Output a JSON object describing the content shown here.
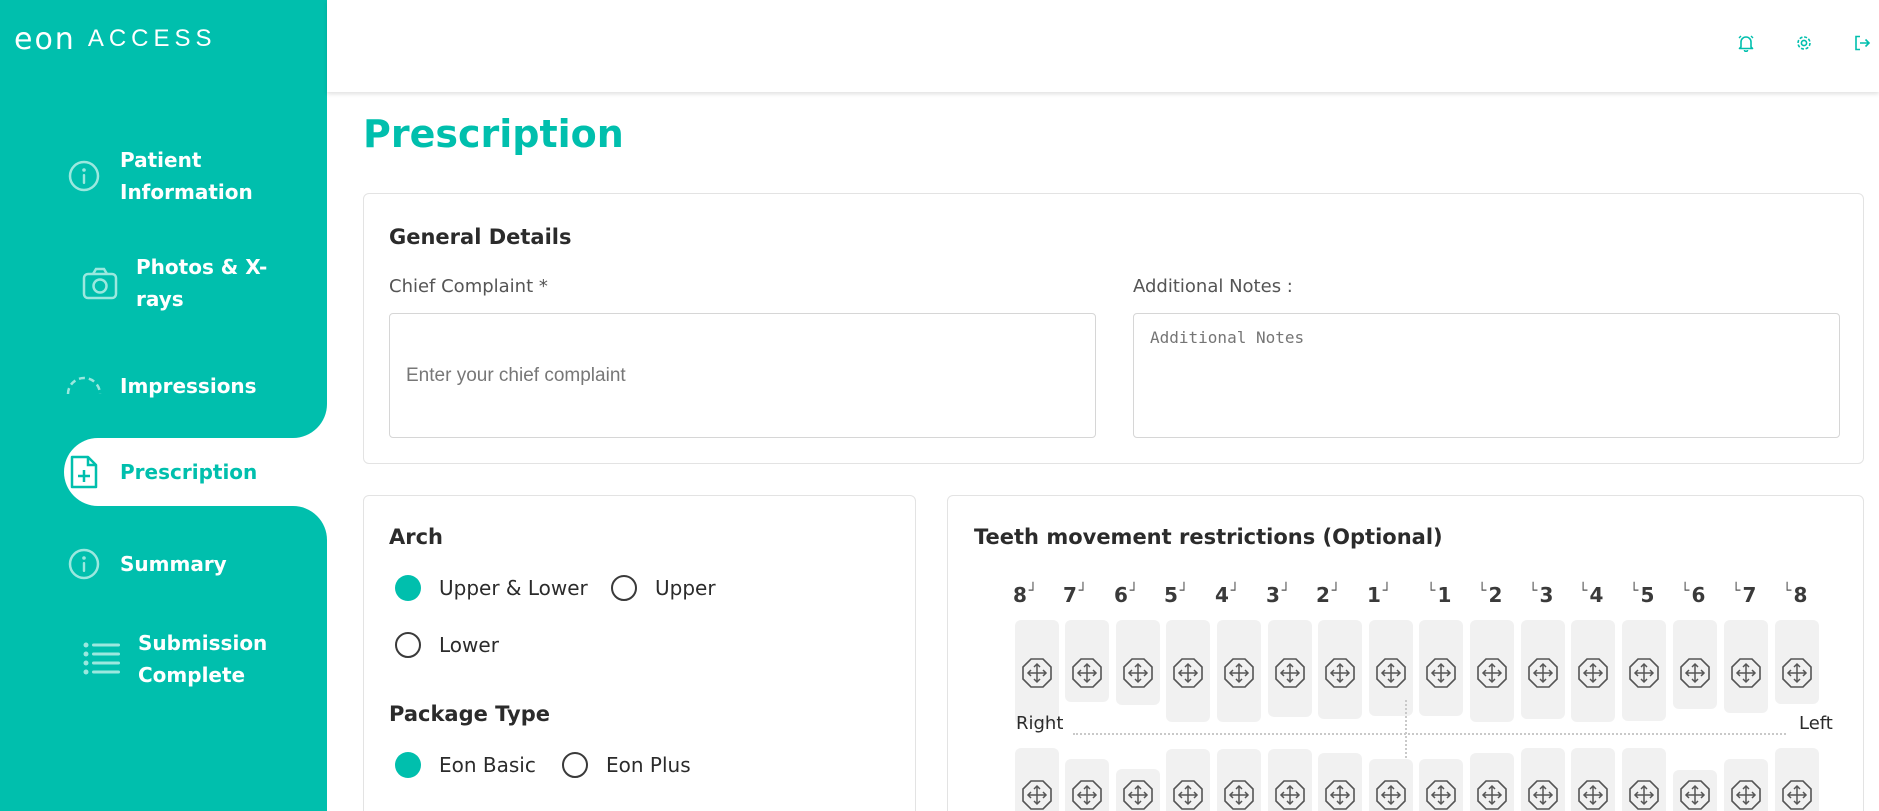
{
  "app": {
    "logo_main": "eon",
    "logo_sub": "ACCESS"
  },
  "colors": {
    "brand": "#00bfad",
    "text": "#2b2b2b",
    "muted": "#555555",
    "border": "#e3e3e3"
  },
  "sidebar": {
    "items": [
      {
        "label": "Patient Information",
        "icon": "info-icon",
        "active": false
      },
      {
        "label": "Photos & X-rays",
        "icon": "camera-icon",
        "active": false
      },
      {
        "label": "Impressions",
        "icon": "arc-icon",
        "active": false
      },
      {
        "label": "Prescription",
        "icon": "document-plus-icon",
        "active": true
      },
      {
        "label": "Summary",
        "icon": "info-icon",
        "active": false
      },
      {
        "label": "Submission Complete",
        "icon": "list-icon",
        "active": false
      }
    ]
  },
  "topbar": {
    "icons": [
      "bell-icon",
      "gear-icon",
      "logout-icon"
    ]
  },
  "page": {
    "title": "Prescription"
  },
  "general_details": {
    "title": "General Details",
    "chief_complaint_label": "Chief Complaint *",
    "chief_complaint_placeholder": "Enter your chief complaint",
    "chief_complaint_value": "",
    "additional_notes_label": "Additional Notes :",
    "additional_notes_placeholder": "Additional Notes",
    "additional_notes_value": ""
  },
  "arch": {
    "title": "Arch",
    "options": [
      "Upper & Lower",
      "Upper",
      "Lower"
    ],
    "selected": "Upper & Lower"
  },
  "package": {
    "title": "Package Type",
    "options": [
      "Eon Basic",
      "Eon Plus"
    ],
    "selected": "Eon Basic"
  },
  "teeth": {
    "title": "Teeth movement restrictions (Optional)",
    "right_numbers": [
      "8",
      "7",
      "6",
      "5",
      "4",
      "3",
      "2",
      "1"
    ],
    "left_numbers": [
      "1",
      "2",
      "3",
      "4",
      "5",
      "6",
      "7",
      "8"
    ],
    "right_label": "Right",
    "left_label": "Left",
    "tooth_icon": "move-arrows-octagon-icon"
  }
}
